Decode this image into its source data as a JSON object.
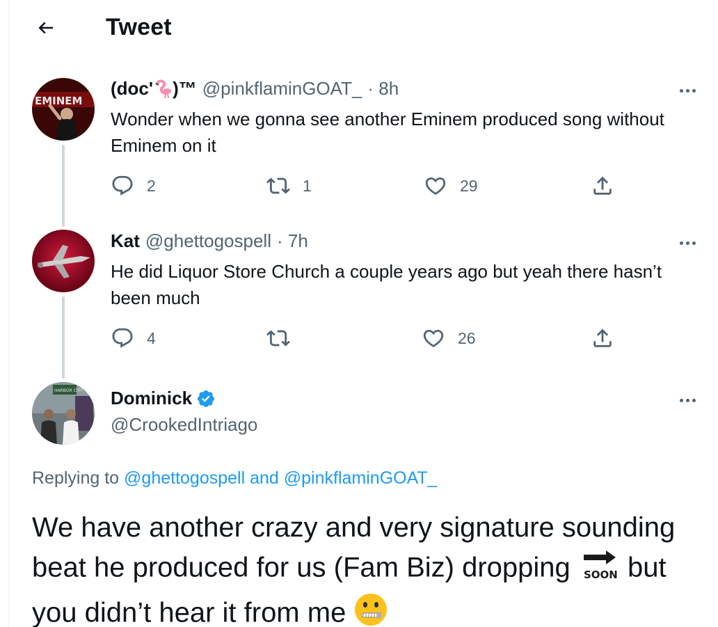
{
  "header": {
    "title": "Tweet",
    "back_icon": "back-arrow-icon"
  },
  "tweets": [
    {
      "name_prefix": "(doc'",
      "name_suffix": ")™",
      "name_emoji": "flamingo-icon",
      "handle": "@pinkflaminGOAT_",
      "time": "· 8h",
      "text": "Wonder when we gonna see another Eminem produced song without Eminem on it",
      "replies": "2",
      "retweets": "1",
      "likes": "29"
    },
    {
      "name": "Kat",
      "handle": "@ghettogospell",
      "time": "· 7h",
      "text": "He did Liquor Store Church a couple years ago but yeah there hasn’t been much",
      "replies": "4",
      "retweets": "",
      "likes": "26"
    }
  ],
  "main_tweet": {
    "name": "Dominick",
    "verified": true,
    "handle": "@CrookedIntriago",
    "replying_prefix": "Replying to",
    "replying_user1": "@ghettogospell",
    "replying_and": "and",
    "replying_user2": "@pinkflaminGOAT_",
    "text_part1": "We have another crazy and very signature sounding beat he produced for us (Fam Biz) dropping",
    "text_part2": "but you didn’t hear it from me",
    "emoji1": "soon-arrow-icon",
    "emoji1_label": "SOON",
    "emoji2": "zipper-mouth-face-icon"
  },
  "avatar_texts": {
    "eminem_sign": "EMINEM",
    "harbor_sign": "HARBOR CITY"
  },
  "colors": {
    "accent": "#1d9bf0",
    "secondary_text": "#536471",
    "thread_line": "#cfd9de"
  }
}
